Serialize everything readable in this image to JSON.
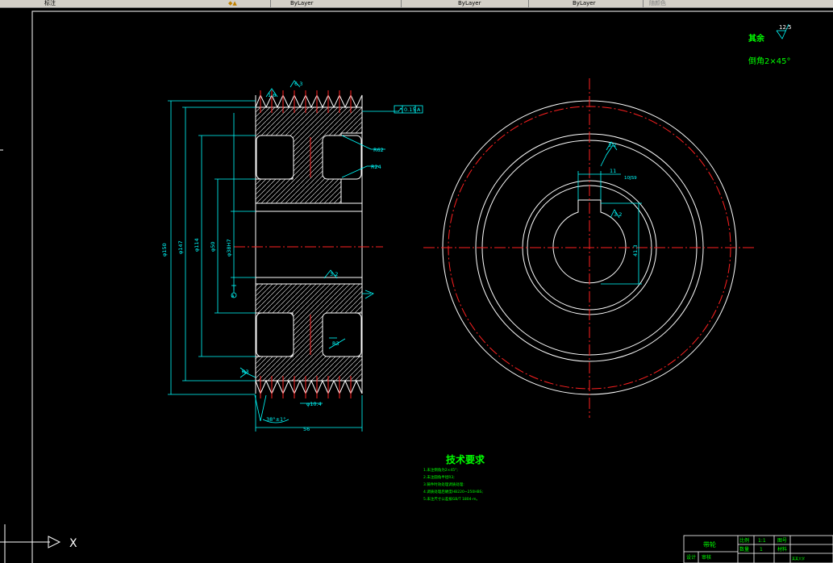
{
  "toolbar": {
    "layer_label": "标注",
    "layer1": "ByLayer",
    "layer2": "ByLayer",
    "layer3": "ByLayer",
    "plot_style": "随颜色"
  },
  "notes": {
    "other_label": "其余",
    "other_rough": "12.5",
    "chamfer": "倒角2×45°"
  },
  "tech": {
    "title": "技术要求",
    "items": [
      "1.未注倒角为2×45°;",
      "2.未注圆角半径R3;",
      "3.铸件时效处理调质处理:",
      "4.调质处理后硬度HB220~250HBS;",
      "5.未注尺寸公差按GB/T 1804-m。"
    ]
  },
  "dims": {
    "d150": "φ150",
    "d147": "φ147",
    "d114": "φ114",
    "d50": "φ50",
    "d38": "φ38H7",
    "r3a": "R3",
    "r3b": "R3",
    "r62": "R62",
    "r24": "R24",
    "w56": "56",
    "w38": "38°±1°",
    "w10": "φ10.4",
    "w11": "11",
    "ra1": "6.3",
    "ra2": "3.2",
    "ra3": "1.6",
    "h41": "41.3",
    "kw": "10JS9",
    "tol": "0.15",
    "datum": "A",
    "datumA": "A"
  },
  "title_block": {
    "part_name": "带轮",
    "scale_label": "比例",
    "scale_value": "1:1",
    "qty_label": "数量",
    "qty_value": "1",
    "no_label": "图号",
    "mat_label": "材料",
    "design_label": "设计",
    "check_label": "审核",
    "school": "某某大学"
  },
  "ucs": {
    "x_label": "X"
  }
}
